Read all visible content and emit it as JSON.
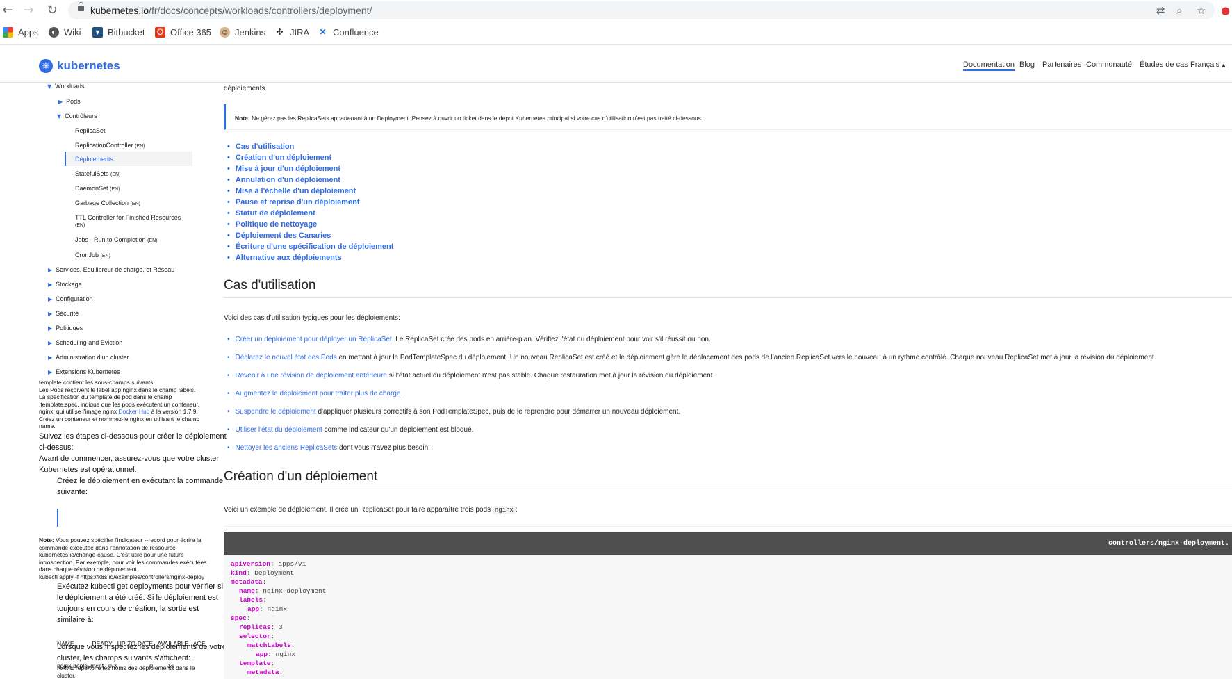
{
  "browser": {
    "url_host": "kubernetes.io",
    "url_path": "/fr/docs/concepts/workloads/controllers/deployment/",
    "bookmarks": [
      "Apps",
      "Wiki",
      "Bitbucket",
      "Office 365",
      "Jenkins",
      "JIRA",
      "Confluence"
    ]
  },
  "header": {
    "brand": "kubernetes",
    "nav": [
      "Documentation",
      "Blog",
      "Partenaires",
      "Communauté",
      "Études de cas",
      "Français"
    ]
  },
  "sidebar": {
    "workloads": "Workloads",
    "pods": "Pods",
    "controleurs": "Contrôleurs",
    "replicaset": "ReplicaSet",
    "replicationcontroller": "ReplicationController",
    "deploiements": "Déploiements",
    "statefulsets": "StatefulSets",
    "daemonset": "DaemonSet",
    "garbage": "Garbage Collection",
    "ttl": "TTL Controller for Finished Resources",
    "jobs": "Jobs - Run to Completion",
    "cronjob": "CronJob",
    "en": "(EN)",
    "services": "Services, Equilibreur de charge, et Réseau",
    "stockage": "Stockage",
    "configuration": "Configuration",
    "securite": "Sécurité",
    "politiques": "Politiques",
    "scheduling": "Scheduling and Eviction",
    "administration": "Administration d'un cluster",
    "extensions": "Extensions Kubernetes"
  },
  "leaked": {
    "l1": "template contient les sous-champs suivants:",
    "l2": "Les Pods reçoivent le label app:nginx dans le champ labels.",
    "l3": "La spécification du template de pod dans le champ",
    "l4": ".template.spec, indique que les pods exécutent un conteneur,",
    "l5a": "nginx, qui utilise l'image nginx ",
    "l5b": "Docker Hub",
    "l5c": " à la version 1.7.9.",
    "l6": "Créez un conteneur et nommez-le nginx en utilisant le champ",
    "l7": "name.",
    "l8": "Suivez les étapes ci-dessous pour créer le déploiement",
    "l9": "ci-dessus:",
    "l10": "Avant de commencer, assurez-vous que votre cluster",
    "l11": "Kubernetes est opérationnel.",
    "l12": "Créez le déploiement en exécutant la commande",
    "l13": "suivante:",
    "n_label": "Note:",
    "n1": " Vous pouvez spécifier l'indicateur --record pour écrire la",
    "n2": "commande exécutée dans l'annotation de ressource",
    "n3": "kubernetes.io/change-cause. C'est utile pour une future",
    "n4": "introspection. Par exemple, pour voir les commandes exécutées",
    "n5": "dans chaque révision de déploiement.",
    "n6": "kubectl apply -f https://k8s.io/examples/controllers/nginx-deploy",
    "g1": "Exécutez kubectl get deployments pour vérifier si",
    "g2": "le déploiement a été créé. Si le déploiement est",
    "g3": "toujours en cours de création, la sortie est",
    "g4": "similaire à:",
    "t1": "NAME           READY   UP-TO-DATE   AVAILABLE   AGE",
    "t2": "nginx-deployment   0/3       0           0         1s",
    "i1": "Lorsque vous inspectez les déploiements de votre",
    "i2": "cluster, les champs suivants s'affichent:",
    "i3": "NAME répertorie les noms des déploiements dans le",
    "i4": "cluster."
  },
  "main": {
    "top_text": "déploiements.",
    "note_label": "Note:",
    "note_text": " Ne gérez pas les ReplicaSets appartenant à un Deployment. Pensez à ouvrir un ticket dans le dépot Kubernetes principal si votre cas d'utilisation n'est pas traité ci-dessous.",
    "toc": [
      "Cas d'utilisation",
      "Création d'un déploiement",
      "Mise à jour d'un déploiement",
      "Annulation d'un déploiement",
      "Mise à l'échelle d'un déploiement",
      "Pause et reprise d'un déploiement",
      "Statut de déploiement",
      "Politique de nettoyage",
      "Déploiement des Canaries",
      "Écriture d'une spécification de déploiement",
      "Alternative aux déploiements"
    ],
    "h_cas": "Cas d'utilisation",
    "cas_intro": "Voici des cas d'utilisation typiques pour les déploiements:",
    "cases": [
      {
        "link": "Créer un déploiement pour déployer un ReplicaSet",
        "rest": ". Le ReplicaSet crée des pods en arrière-plan. Vérifiez l'état du déploiement pour voir s'il réussit ou non."
      },
      {
        "link": "Déclarez le nouvel état des Pods",
        "rest": " en mettant à jour le PodTemplateSpec du déploiement. Un nouveau ReplicaSet est créé et le déploiement gère le déplacement des pods de l'ancien ReplicaSet vers le nouveau à un rythme contrôlé. Chaque nouveau ReplicaSet met à jour la révision du déploiement."
      },
      {
        "link": "Revenir à une révision de déploiement antérieure",
        "rest": " si l'état actuel du déploiement n'est pas stable. Chaque restauration met à jour la révision du déploiement."
      },
      {
        "link": "Augmentez le déploiement pour traiter plus de charge",
        "rest": "."
      },
      {
        "link": "Suspendre le déploiement",
        "rest": " d'appliquer plusieurs correctifs à son PodTemplateSpec, puis de le reprendre pour démarrer un nouveau déploiement."
      },
      {
        "link": "Utiliser l'état du déploiement",
        "rest": " comme indicateur qu'un déploiement est bloqué."
      },
      {
        "link": "Nettoyer les anciens ReplicaSets",
        "rest": " dont vous n'avez plus besoin."
      }
    ],
    "h_creation": "Création d'un déploiement",
    "creation_intro": "Voici un exemple de déploiement. Il crée un ReplicaSet pour faire apparaître trois pods ",
    "creation_code": "nginx",
    "creation_end": ":",
    "code_file": "controllers/nginx-deployment.",
    "code": [
      {
        "k": "apiVersion",
        "v": " apps/v1"
      },
      {
        "k": "kind",
        "v": " Deployment"
      },
      {
        "k": "metadata",
        "v": ""
      },
      {
        "k": "name",
        "v": " nginx-deployment"
      },
      {
        "k": "labels",
        "v": ""
      },
      {
        "k": "app",
        "v": " nginx"
      },
      {
        "k": "spec",
        "v": ""
      },
      {
        "k": "replicas",
        "v": " 3"
      },
      {
        "k": "selector",
        "v": ""
      },
      {
        "k": "matchLabels",
        "v": ""
      },
      {
        "k": "app",
        "v": " nginx"
      },
      {
        "k": "template",
        "v": ""
      },
      {
        "k": "metadata",
        "v": ""
      }
    ]
  }
}
